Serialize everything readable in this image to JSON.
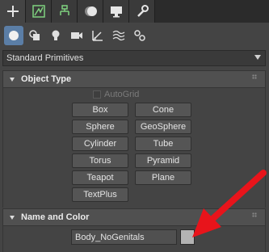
{
  "tabs": [
    {
      "icon": "plus-icon",
      "label": "Create"
    },
    {
      "icon": "modify-icon",
      "label": "Modify"
    },
    {
      "icon": "hierarchy-icon",
      "label": "Hierarchy"
    },
    {
      "icon": "motion-icon",
      "label": "Motion"
    },
    {
      "icon": "display-icon",
      "label": "Display"
    },
    {
      "icon": "utilities-icon",
      "label": "Utilities"
    }
  ],
  "subtoolbar": [
    {
      "icon": "geometry-icon",
      "active": true
    },
    {
      "icon": "shapes-icon",
      "active": false
    },
    {
      "icon": "lights-icon",
      "active": false
    },
    {
      "icon": "cameras-icon",
      "active": false
    },
    {
      "icon": "helpers-icon",
      "active": false
    },
    {
      "icon": "spacewarps-icon",
      "active": false
    },
    {
      "icon": "systems-icon",
      "active": false
    }
  ],
  "category_dropdown": {
    "selected": "Standard Primitives"
  },
  "object_type": {
    "title": "Object Type",
    "autogrid_label": "AutoGrid",
    "autogrid_checked": false,
    "buttons": [
      "Box",
      "Cone",
      "Sphere",
      "GeoSphere",
      "Cylinder",
      "Tube",
      "Torus",
      "Pyramid",
      "Teapot",
      "Plane",
      "TextPlus"
    ]
  },
  "name_and_color": {
    "title": "Name and Color",
    "name_value": "Body_NoGenitals",
    "swatch_color": "#b3b3b3"
  },
  "colors": {
    "panel_bg": "#444444",
    "active_blue": "#5b7ea6",
    "arrow_red": "#e8141b"
  }
}
